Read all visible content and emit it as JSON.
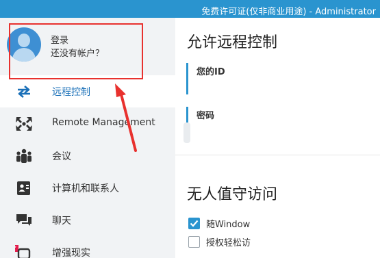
{
  "window": {
    "title": "免费许可证(仅非商业用途) - Administrator"
  },
  "account": {
    "login": "登录",
    "no_account": "还没有帐户？"
  },
  "nav": {
    "items": [
      {
        "label": "远程控制",
        "icon": "arrows-swap-icon",
        "active": true
      },
      {
        "label": "Remote Management",
        "icon": "remote-management-icon",
        "active": false
      },
      {
        "label": "会议",
        "icon": "meeting-people-icon",
        "active": false
      },
      {
        "label": "计算机和联系人",
        "icon": "contacts-card-icon",
        "active": false
      },
      {
        "label": "聊天",
        "icon": "chat-icon",
        "active": false
      },
      {
        "label": "增强现实",
        "icon": "augmented-reality-icon",
        "active": false
      }
    ]
  },
  "main": {
    "remote_control": {
      "title": "允许远程控制",
      "id_label": "您的ID",
      "password_label": "密码"
    },
    "unattended": {
      "title": "无人值守访问",
      "options": [
        {
          "label": "随Window",
          "checked": true
        },
        {
          "label": "授权轻松访",
          "checked": false
        }
      ]
    }
  },
  "colors": {
    "accent": "#2a94cf",
    "annotation": "#e8312e",
    "sidebar_bg": "#f1f3f5"
  }
}
